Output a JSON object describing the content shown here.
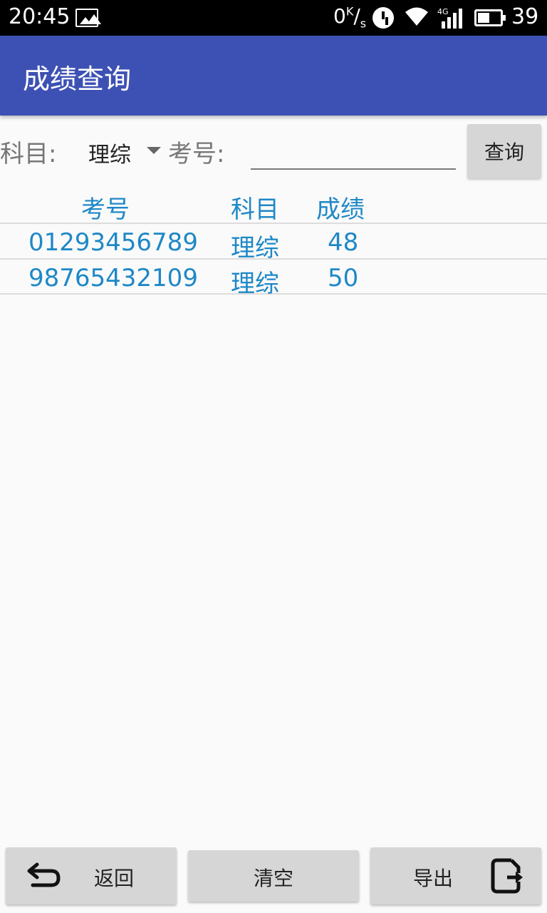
{
  "status_bar": {
    "time": "20:45",
    "speed": "0 K/s",
    "battery": "39",
    "network": "4G",
    "icons": [
      "image-icon",
      "alarm-icon",
      "wifi-icon",
      "signal-icon",
      "battery-icon"
    ]
  },
  "app_bar": {
    "title": "成绩查询",
    "color": "#3d51b4"
  },
  "filter": {
    "subject_label": "科目:",
    "subject_value": "理综",
    "exam_label": "考号:",
    "exam_value": "",
    "query_button": "查询"
  },
  "table": {
    "headers": [
      "考号",
      "科目",
      "成绩"
    ],
    "rows": [
      {
        "exam_no": "01293456789",
        "subject": "理综",
        "score": "48"
      },
      {
        "exam_no": "98765432109",
        "subject": "理综",
        "score": "50"
      }
    ]
  },
  "bottom_bar": {
    "back": "返回",
    "clear": "清空",
    "export": "导出"
  },
  "accent_color": "#1e88c7"
}
